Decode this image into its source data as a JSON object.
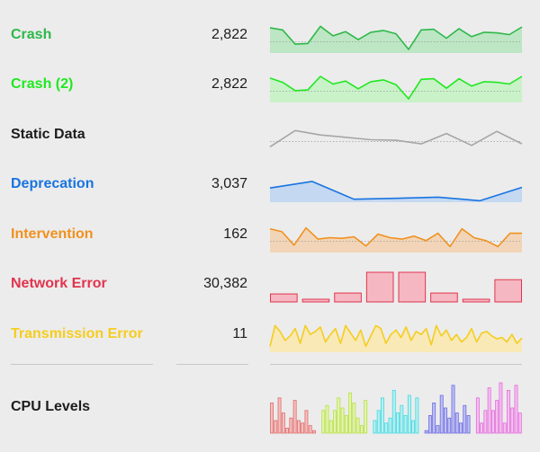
{
  "rows": [
    {
      "label": "Crash",
      "value": "2,822",
      "type": "area",
      "color": "#2db84a",
      "fill": "#bde6c4",
      "refLine": true,
      "values": [
        85,
        78,
        30,
        32,
        90,
        58,
        72,
        45,
        70,
        76,
        65,
        12,
        78,
        80,
        50,
        82,
        55,
        70,
        68,
        62,
        88
      ]
    },
    {
      "label": "Crash (2)",
      "value": "2,822",
      "type": "area",
      "color": "#1fe81f",
      "fill": "#c9f2c9",
      "refLine": true,
      "values": [
        82,
        68,
        40,
        42,
        88,
        62,
        72,
        46,
        70,
        76,
        60,
        12,
        78,
        80,
        48,
        80,
        55,
        70,
        68,
        62,
        88
      ]
    },
    {
      "label": "Static Data",
      "value": "",
      "type": "line",
      "color": "#a6a6a6",
      "refLine": true,
      "values": [
        20,
        75,
        60,
        52,
        44,
        42,
        30,
        65,
        25,
        72,
        30
      ]
    },
    {
      "label": "Deprecation",
      "value": "3,037",
      "type": "area",
      "color": "#1874e0",
      "fill": "#c4d8f2",
      "refLine": false,
      "values": [
        48,
        70,
        10,
        13,
        17,
        5,
        50
      ]
    },
    {
      "label": "Intervention",
      "value": "162",
      "type": "area",
      "color": "#f0911e",
      "fill": "#f2d5b8",
      "refLine": true,
      "values": [
        80,
        70,
        25,
        83,
        45,
        50,
        48,
        53,
        22,
        62,
        50,
        45,
        55,
        40,
        65,
        20,
        80,
        50,
        40,
        20,
        65,
        65
      ]
    },
    {
      "label": "Network Error",
      "value": "30,382",
      "type": "bar",
      "color": "#e0354e",
      "fill": "#f5b8c2",
      "refLine": false,
      "values": [
        27,
        8,
        30,
        100,
        100,
        30,
        8,
        75
      ]
    },
    {
      "label": "Transmission Error",
      "value": "11",
      "type": "area",
      "color": "#f5cd1e",
      "fill": "#f8e9b6",
      "refLine": false,
      "values": [
        20,
        90,
        70,
        40,
        55,
        80,
        30,
        90,
        60,
        70,
        85,
        35,
        60,
        80,
        30,
        90,
        65,
        40,
        75,
        20,
        55,
        90,
        80,
        30,
        60,
        75,
        50,
        85,
        40,
        70,
        60,
        80,
        25,
        90,
        55,
        75,
        40,
        60,
        35,
        50,
        80,
        35,
        65,
        70,
        55,
        45,
        50,
        35,
        60,
        30,
        48
      ]
    }
  ],
  "cpu": {
    "label": "CPU Levels",
    "groups": [
      {
        "color": "#e06a6a",
        "fill": "#f5c0c0",
        "values": [
          60,
          25,
          70,
          40,
          10,
          30,
          65,
          25,
          20,
          45,
          15,
          5
        ]
      },
      {
        "color": "#b8e040",
        "fill": "#e2f5b0",
        "values": [
          45,
          55,
          25,
          45,
          70,
          50,
          35,
          80,
          60,
          30,
          15,
          65
        ]
      },
      {
        "color": "#40d8e0",
        "fill": "#b8f0f2",
        "values": [
          25,
          45,
          70,
          20,
          30,
          85,
          40,
          55,
          35,
          75,
          25,
          70
        ]
      },
      {
        "color": "#6a6ae0",
        "fill": "#c0c0f5",
        "values": [
          5,
          35,
          60,
          15,
          75,
          50,
          30,
          95,
          40,
          20,
          55,
          35
        ]
      },
      {
        "color": "#e06ad8",
        "fill": "#f5c0f0",
        "values": [
          70,
          20,
          45,
          90,
          45,
          65,
          100,
          20,
          85,
          50,
          95,
          40
        ]
      }
    ]
  }
}
